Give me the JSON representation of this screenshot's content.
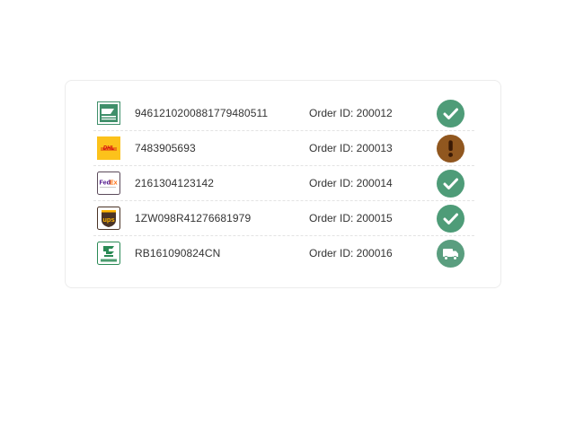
{
  "colors": {
    "delivered": "#4e9c78",
    "exception": "#7a4418",
    "exception_dot": "#e8a13a",
    "in_transit": "#5a9e7f",
    "card_border": "#ececec",
    "divider": "#e3e3e3"
  },
  "shipments": [
    {
      "carrier_icon": "usps-icon",
      "tracking_number": "9461210200881779480511",
      "order_label": "Order ID: 200012",
      "status_icon": "check-icon",
      "status": "delivered"
    },
    {
      "carrier_icon": "dhl-icon",
      "tracking_number": "7483905693",
      "order_label": "Order ID: 200013",
      "status_icon": "exclamation-icon",
      "status": "exception"
    },
    {
      "carrier_icon": "fedex-icon",
      "tracking_number": "2161304123142",
      "order_label": "Order ID: 200014",
      "status_icon": "check-icon",
      "status": "delivered"
    },
    {
      "carrier_icon": "ups-icon",
      "tracking_number": "1ZW098R41276681979",
      "order_label": "Order ID: 200015",
      "status_icon": "check-icon",
      "status": "delivered"
    },
    {
      "carrier_icon": "china-post-icon",
      "tracking_number": "RB161090824CN",
      "order_label": "Order ID: 200016",
      "status_icon": "truck-icon",
      "status": "in_transit"
    }
  ]
}
